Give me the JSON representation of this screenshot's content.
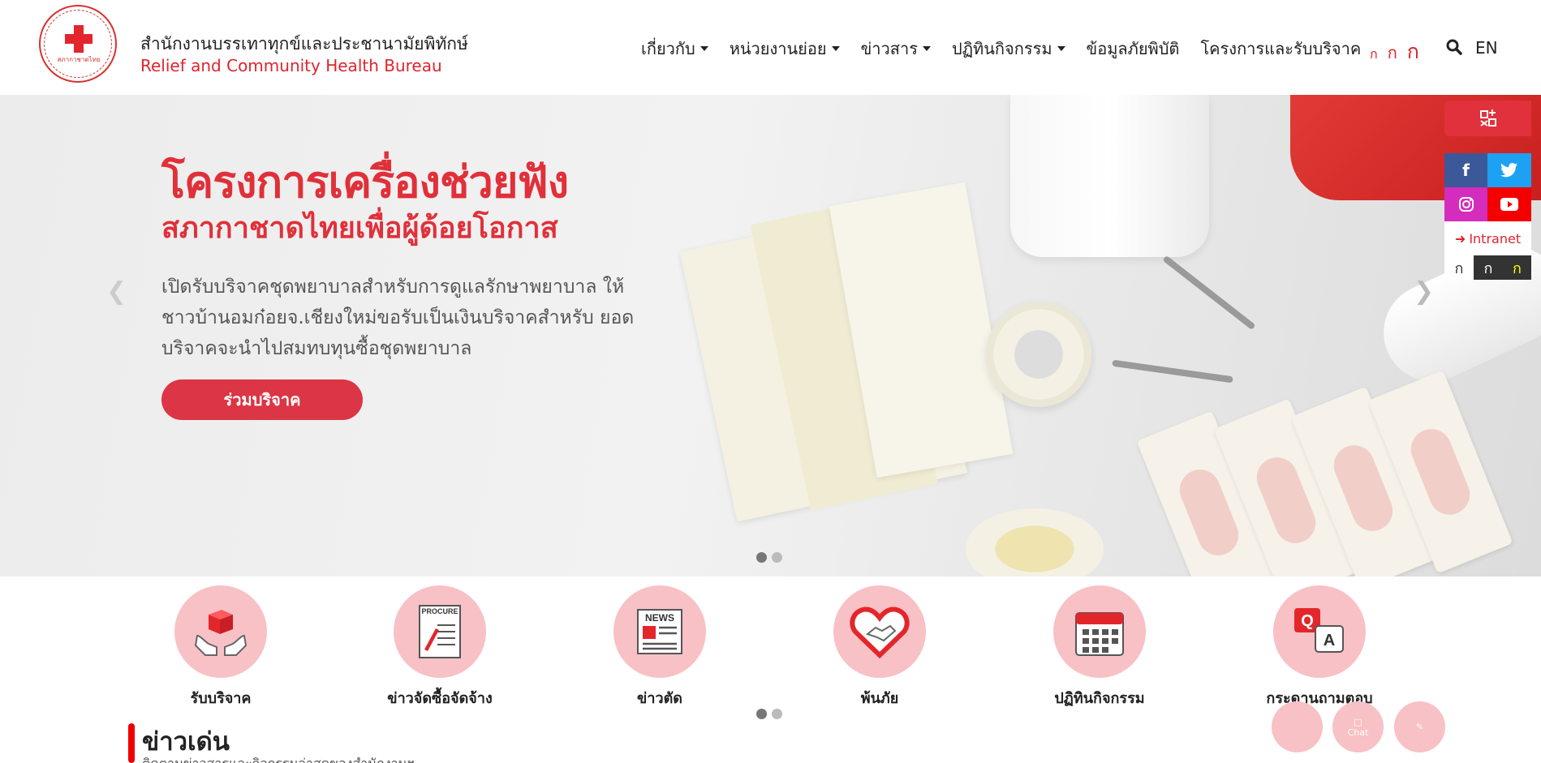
{
  "header": {
    "org_name_th": "สำนักงานบรรเทาทุกข์และประชานามัยพิทักษ์",
    "org_name_en": "Relief and Community Health Bureau",
    "logo_text": "สภากาชาดไทย",
    "nav": [
      {
        "label": "เกี่ยวกับ",
        "dropdown": true
      },
      {
        "label": "หน่วยงานย่อย",
        "dropdown": true
      },
      {
        "label": "ข่าวสาร",
        "dropdown": true
      },
      {
        "label": "ปฏิทินกิจกรรม",
        "dropdown": true
      },
      {
        "label": "ข้อมูลภัยพิบัติ",
        "dropdown": false
      },
      {
        "label": "โครงการและรับบริจาค",
        "dropdown": false
      }
    ],
    "font_sizes": [
      "ก",
      "ก",
      "ก"
    ],
    "language": "EN"
  },
  "hero": {
    "title": "โครงการเครื่องช่วยฟัง",
    "subtitle": "สภากาชาดไทยเพื่อผู้ด้อยโอกาส",
    "description": "เปิดรับบริจาคชุดพยาบาลสำหรับการดูแลรักษาพยาบาล ให้ชาวบ้านอมก๋อยจ.เชียงใหม่ขอรับเป็นเงินบริจาคสำหรับ ยอดบริจาคจะนำไปสมทบทุนซื้อชุดพยาบาล",
    "button": "ร่วมบริจาค",
    "slide_count": 2,
    "active_slide": 1
  },
  "side_panel": {
    "intranet_label": "Intranet",
    "contrast": [
      "ก",
      "ก",
      "ก"
    ],
    "social": [
      "facebook-icon",
      "twitter-icon",
      "instagram-icon",
      "youtube-icon"
    ]
  },
  "quick_links": [
    {
      "label": "รับบริจาค",
      "icon": "donation-box-icon"
    },
    {
      "label": "ข่าวจัดซื้อจัดจ้าง",
      "icon": "procure-document-icon",
      "icon_text": "PROCURE"
    },
    {
      "label": "ข่าวตัด",
      "icon": "newspaper-icon",
      "icon_text": "NEWS"
    },
    {
      "label": "พ้นภัย",
      "icon": "heart-handshake-icon"
    },
    {
      "label": "ปฏิทินกิจกรรม",
      "icon": "calendar-icon"
    },
    {
      "label": "กระดานถามตอบ",
      "icon": "qa-icon",
      "icon_text_q": "Q",
      "icon_text_a": "A"
    }
  ],
  "featured_news": {
    "title": "ข่าวเด่น",
    "subtitle": "ติดตามข่าวสารและกิจกรรมล่าสุดของสำนักงานฯ"
  },
  "floating_buttons": {
    "chat_label": "Chat"
  },
  "colors": {
    "brand_red": "#e0242d",
    "button_red": "#dc3545",
    "quick_circle": "#f8c1c5"
  }
}
